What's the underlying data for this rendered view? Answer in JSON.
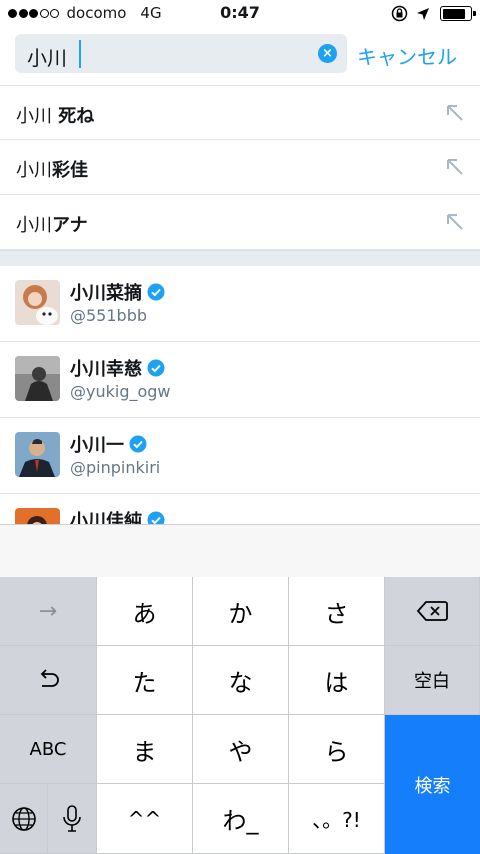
{
  "status_bar": {
    "carrier": "docomo",
    "network": "4G",
    "time": "0:47"
  },
  "search": {
    "value": "小川",
    "cancel_label": "キャンセル"
  },
  "suggestions": [
    {
      "prefix": "小川",
      "suffix": " 死ね"
    },
    {
      "prefix": "小川",
      "suffix": "彩佳"
    },
    {
      "prefix": "小川",
      "suffix": "アナ"
    }
  ],
  "users": [
    {
      "name": "小川菜摘",
      "handle": "@551bbb"
    },
    {
      "name": "小川幸慈",
      "handle": "@yukig_ogw"
    },
    {
      "name": "小川一",
      "handle": "@pinpinkiri"
    },
    {
      "name": "小川佳純",
      "handle": ""
    }
  ],
  "keyboard": {
    "next_label": "→",
    "row1": [
      "あ",
      "か",
      "さ"
    ],
    "row2": [
      "た",
      "な",
      "は"
    ],
    "row3": [
      "ま",
      "や",
      "ら"
    ],
    "row4": [
      "^^",
      "わ_",
      "、。?!"
    ],
    "space_label": "空白",
    "abc_label": "ABC",
    "search_label": "検索"
  },
  "colors": {
    "accent": "#1da1f2",
    "keyboard_action": "#147efb"
  }
}
